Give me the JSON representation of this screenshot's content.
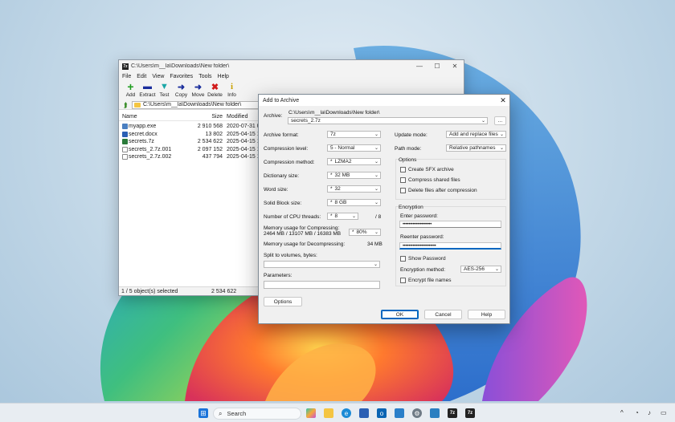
{
  "file_manager": {
    "title": "C:\\Users\\m__la\\Downloads\\New folder\\",
    "menu": [
      "File",
      "Edit",
      "View",
      "Favorites",
      "Tools",
      "Help"
    ],
    "toolbar": [
      {
        "label": "Add",
        "icon": "add-icon",
        "glyph": "+",
        "color": "#1f9d1f"
      },
      {
        "label": "Extract",
        "icon": "extract-icon",
        "glyph": "▬",
        "color": "#1a2d9c"
      },
      {
        "label": "Test",
        "icon": "test-icon",
        "glyph": "▼",
        "color": "#1aa6a6"
      },
      {
        "label": "Copy",
        "icon": "copy-icon",
        "glyph": "➜",
        "color": "#1a2d9c"
      },
      {
        "label": "Move",
        "icon": "move-icon",
        "glyph": "➜",
        "color": "#1a2d9c"
      },
      {
        "label": "Delete",
        "icon": "delete-icon",
        "glyph": "✖",
        "color": "#d11a1a"
      },
      {
        "label": "Info",
        "icon": "info-icon",
        "glyph": "i",
        "color": "#c9a100"
      }
    ],
    "address": "C:\\Users\\m__la\\Downloads\\New folder\\",
    "columns": {
      "name": "Name",
      "size": "Size",
      "modified": "Modified"
    },
    "files": [
      {
        "name": "myapp.exe",
        "size": "2 910 568",
        "modified": "2020-07-31 07:",
        "icon": "exe-icon",
        "color": "#4a7fc1"
      },
      {
        "name": "secret.docx",
        "size": "13 802",
        "modified": "2025-04-15 12:",
        "icon": "docx-icon",
        "color": "#2b5fb4"
      },
      {
        "name": "secrets.7z",
        "size": "2 534 622",
        "modified": "2025-04-15 12:",
        "icon": "archive-icon",
        "color": "#2a7a3a"
      },
      {
        "name": "secrets_2.7z.001",
        "size": "2 097 152",
        "modified": "2025-04-15 12:",
        "icon": "file-icon",
        "color": "#ffffff"
      },
      {
        "name": "secrets_2.7z.002",
        "size": "437 794",
        "modified": "2025-04-15 12:",
        "icon": "file-icon",
        "color": "#ffffff"
      }
    ],
    "status_left": "1 / 5 object(s) selected",
    "status_size": "2 534 622"
  },
  "dialog": {
    "title": "Add to Archive",
    "archive_label": "Archive:",
    "archive_path": "C:\\Users\\m__la\\Downloads\\New folder\\",
    "archive_name": "secrets_2.7z",
    "browse": "...",
    "archive_format_label": "Archive format:",
    "archive_format": "7z",
    "compression_level_label": "Compression level:",
    "compression_level": "5 - Normal",
    "compression_method_label": "Compression method:",
    "compression_method": "LZMA2",
    "dictionary_size_label": "Dictionary size:",
    "dictionary_size": "32 MB",
    "word_size_label": "Word size:",
    "word_size": "32",
    "solid_block_label": "Solid Block size:",
    "solid_block": "8 GB",
    "cpu_threads_label": "Number of CPU threads:",
    "cpu_threads": "8",
    "cpu_threads_max": "/ 8",
    "mem_compress_label": "Memory usage for Compressing:",
    "mem_compress_detail": "2464 MB / 13107 MB / 16383 MB",
    "mem_percent": "80%",
    "mem_decompress_label": "Memory usage for Decompressing:",
    "mem_decompress": "34 MB",
    "split_label": "Split to volumes, bytes:",
    "params_label": "Parameters:",
    "options_button": "Options",
    "update_mode_label": "Update mode:",
    "update_mode": "Add and replace files",
    "path_mode_label": "Path mode:",
    "path_mode": "Relative pathnames",
    "options_group": "Options",
    "create_sfx": "Create SFX archive",
    "compress_shared": "Compress shared files",
    "delete_after": "Delete files after compression",
    "encryption_group": "Encryption",
    "enter_password_label": "Enter password:",
    "enter_password": "••••••••••••••••••••",
    "reenter_password_label": "Reenter password:",
    "reenter_password": "•••••••••••••••••••••••",
    "show_password": "Show Password",
    "encryption_method_label": "Encryption method:",
    "encryption_method": "AES-256",
    "encrypt_names": "Encrypt file names",
    "ok": "OK",
    "cancel": "Cancel",
    "help": "Help"
  },
  "taskbar": {
    "search": "Search"
  }
}
